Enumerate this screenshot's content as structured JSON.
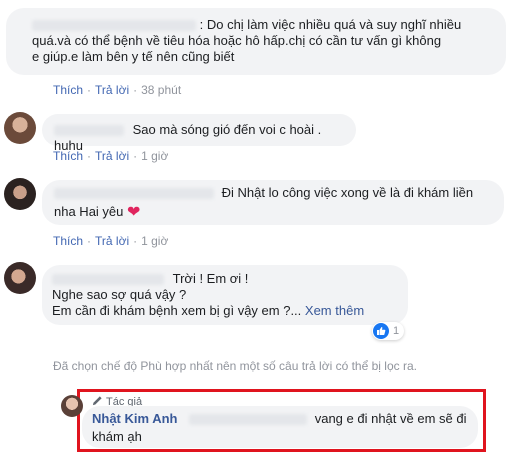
{
  "comments": [
    {
      "name_hidden": true,
      "text_line1": ": Do chị làm việc nhiều quá và suy nghĩ nhiều",
      "text_line2": "quá.và có thể bệnh về tiêu hóa hoặc hô hấp.chị có cần tư vấn gì không",
      "text_line3": "e giúp.e làm bên y tế nên cũng biết",
      "like": "Thích",
      "reply": "Trả lời",
      "time": "38 phút"
    },
    {
      "text": "Sao mà sóng gió đến voi c hoài . huhu",
      "like": "Thích",
      "reply": "Trả lời",
      "time": "1 giờ"
    },
    {
      "text_line1": "Đi Nhật lo công việc xong về là đi khám liền",
      "text_line2": "nha Hai yêu",
      "emoji": "❤",
      "like": "Thích",
      "reply": "Trả lời",
      "time": "1 giờ"
    },
    {
      "text_line1": "Trời ! Em ơi !",
      "text_line2": "Nghe sao sợ quá vậy ?",
      "text_line3": "Em cần đi khám bệnh xem bị gì vậy em ?...",
      "see_more": "Xem thêm",
      "reaction_count": "1"
    }
  ],
  "filter_note": "Đã chọn chế độ Phù hợp nhất nên một số câu trả lời có thể bị lọc ra.",
  "author_reply": {
    "badge": "Tác giả",
    "name": "Nhật Kim Anh",
    "text_line1": "vang e đi nhật về em sẽ đi",
    "text_line2": "khám ạh"
  },
  "colors": {
    "link": "#4267b2",
    "name": "#385898",
    "meta": "#90949c",
    "bubble": "#f2f3f5",
    "highlight": "#e0141e",
    "heart": "#e0245e",
    "like": "#1877f2"
  }
}
